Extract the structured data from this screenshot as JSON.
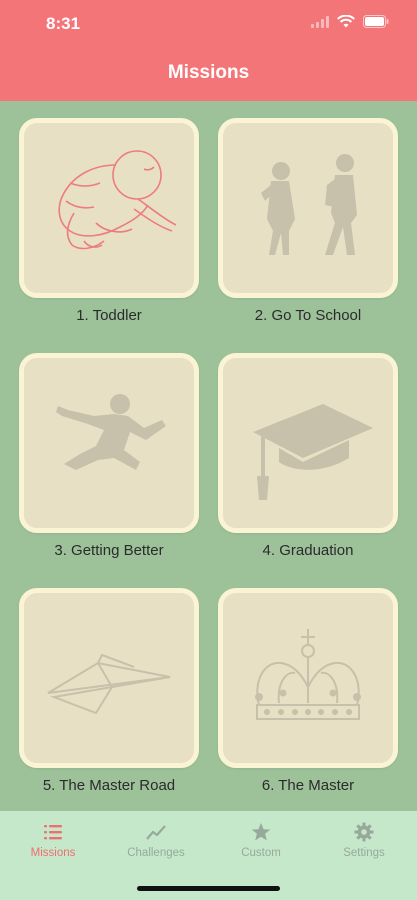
{
  "status": {
    "time": "8:31"
  },
  "header": {
    "title": "Missions"
  },
  "missions": [
    {
      "label": "1. Toddler",
      "icon": "toddler-icon",
      "highlighted": true
    },
    {
      "label": "2. Go To School",
      "icon": "school-children-icon",
      "highlighted": false
    },
    {
      "label": "3. Getting Better",
      "icon": "jumping-person-icon",
      "highlighted": false
    },
    {
      "label": "4. Graduation",
      "icon": "graduation-cap-icon",
      "highlighted": false
    },
    {
      "label": "5. The Master Road",
      "icon": "paper-plane-icon",
      "highlighted": false
    },
    {
      "label": "6. The Master",
      "icon": "crown-icon",
      "highlighted": false
    }
  ],
  "tabs": [
    {
      "label": "Missions",
      "icon": "list-icon",
      "active": true
    },
    {
      "label": "Challenges",
      "icon": "trend-line-icon",
      "active": false
    },
    {
      "label": "Custom",
      "icon": "star-icon",
      "active": false
    },
    {
      "label": "Settings",
      "icon": "gear-icon",
      "active": false
    }
  ],
  "colors": {
    "header": "#f47578",
    "background": "#9dc29a",
    "tile": "#e8e0c4",
    "tile_border": "#fbf4d4",
    "tabbar": "#c5e8cb",
    "active": "#f16d6f",
    "inactive": "#97a99a"
  }
}
